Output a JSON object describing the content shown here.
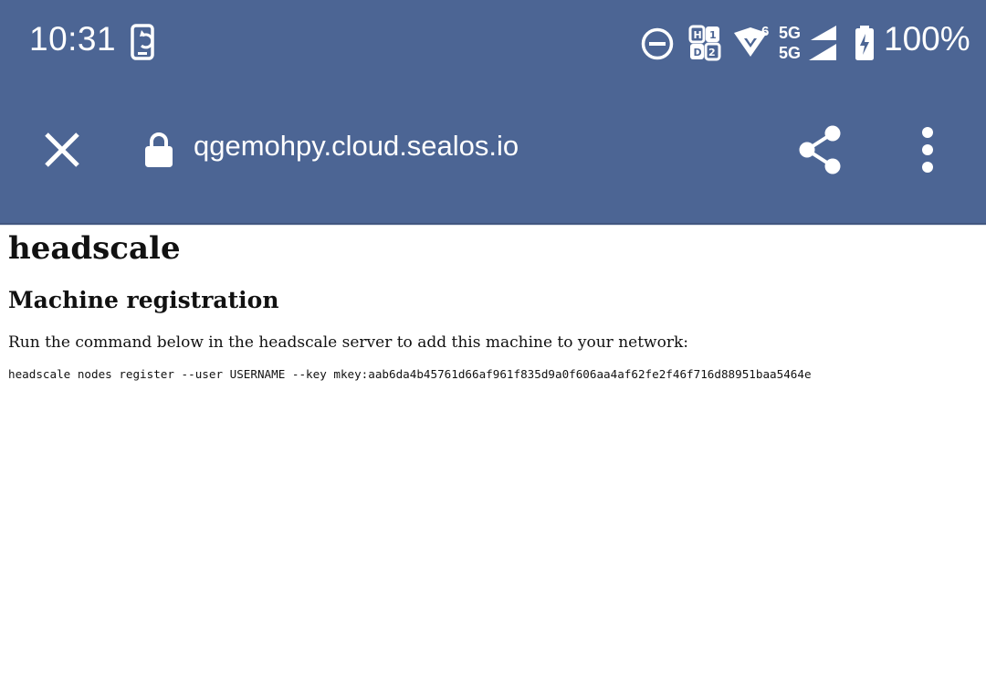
{
  "status_bar": {
    "time": "10:31",
    "network_primary": "5G",
    "network_secondary": "5G",
    "wifi_badge": "6",
    "battery_percent": "100%",
    "icons": [
      "screen-rotate-icon",
      "do-not-disturb-icon",
      "hd-volte-icon",
      "wifi-icon",
      "signal-icon",
      "battery-charging-icon"
    ]
  },
  "toolbar": {
    "url": "qgemohpy.cloud.sealos.io",
    "icons": [
      "close-icon",
      "lock-icon",
      "share-icon",
      "more-vert-icon"
    ]
  },
  "page": {
    "title": "headscale",
    "heading": "Machine registration",
    "instruction": "Run the command below in the headscale server to add this machine to your network:",
    "command": "headscale nodes register --user USERNAME --key mkey:aab6da4b45761d66af961f835d9a0f606aa4af62fe2f46f716d88951baa5464e"
  },
  "colors": {
    "toolbar_bg": "#4c6594",
    "page_bg": "#ffffff",
    "text": "#111111"
  }
}
